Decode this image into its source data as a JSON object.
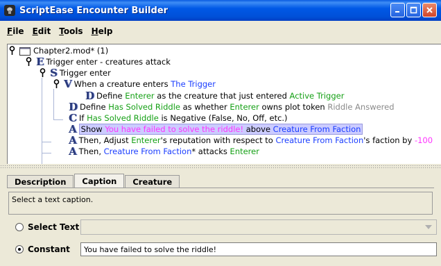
{
  "window": {
    "title": "ScriptEase Encounter Builder",
    "accent": "#0058e6"
  },
  "menu": [
    {
      "mnemonic": "F",
      "rest": "ile"
    },
    {
      "mnemonic": "E",
      "rest": "dit"
    },
    {
      "mnemonic": "T",
      "rest": "ools"
    },
    {
      "mnemonic": "H",
      "rest": "elp"
    }
  ],
  "tree": {
    "root": {
      "icon": "folder-icon",
      "text": "Chapter2.mod* (1)"
    },
    "encounter": {
      "letter": "E",
      "text": "Trigger enter - creatures attack"
    },
    "situation": {
      "letter": "S",
      "text": "Trigger enter"
    },
    "trigger": {
      "letter": "V",
      "parts": [
        "When a creature enters ",
        "The Trigger"
      ]
    },
    "define1": {
      "letter": "D",
      "parts": [
        "Define ",
        "Enterer",
        " as the creature that just entered ",
        "Active Trigger"
      ]
    },
    "define2": {
      "letter": "D",
      "parts": [
        "Define ",
        "Has Solved Riddle",
        " as whether ",
        "Enterer",
        " owns plot token ",
        "Riddle Answered"
      ]
    },
    "condition": {
      "letter": "C",
      "parts": [
        "If ",
        "Has Solved Riddle",
        " is Negative (False, No, Off, etc.)"
      ]
    },
    "action1": {
      "letter": "A",
      "parts": [
        "Show ",
        "You have failed to solve the riddle!",
        " above ",
        "Creature From Faction"
      ]
    },
    "action2": {
      "letter": "A",
      "parts": [
        "Then, Adjust ",
        "Enterer",
        "'s reputation with respect to ",
        "Creature From Faction",
        "'s faction by ",
        "-100"
      ]
    },
    "action3": {
      "letter": "A",
      "parts": [
        "Then, ",
        "Creature From Faction",
        "* attacks ",
        "Enterer"
      ]
    }
  },
  "tabs": [
    "Description",
    "Caption",
    "Creature"
  ],
  "active_tab": "Caption",
  "caption": {
    "description": "Select a text caption.",
    "select_text_label": "Select Text",
    "constant_label": "Constant",
    "constant_value": "You have failed to solve the riddle!",
    "selected_option": "Constant"
  }
}
